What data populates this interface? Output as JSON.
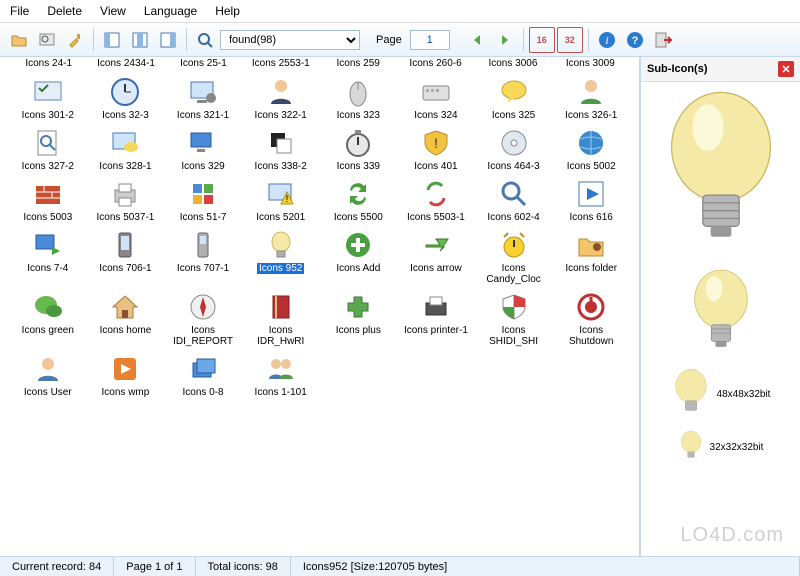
{
  "menu": [
    "File",
    "Delete",
    "View",
    "Language",
    "Help"
  ],
  "toolbar": {
    "dropdown": "found(98)",
    "page_label": "Page",
    "page_value": "1",
    "size_16": "16",
    "size_32": "32"
  },
  "header_row": [
    "Icons 24-1",
    "Icons 2434-1",
    "Icons 25-1",
    "Icons 2553-1",
    "Icons 259",
    "Icons 260-6",
    "Icons 3006",
    "Icons 3009"
  ],
  "grid": [
    {
      "name": "checklist-icon",
      "label": "Icons 301-2"
    },
    {
      "name": "clock-icon",
      "label": "Icons 32-3"
    },
    {
      "name": "monitor-gear-icon",
      "label": "Icons 321-1"
    },
    {
      "name": "user-suit-icon",
      "label": "Icons 322-1"
    },
    {
      "name": "mouse-icon",
      "label": "Icons 323"
    },
    {
      "name": "keyboard-icon",
      "label": "Icons 324"
    },
    {
      "name": "speech-bubble-icon",
      "label": "Icons 325"
    },
    {
      "name": "user-green-icon",
      "label": "Icons 326-1"
    },
    {
      "name": "search-page-icon",
      "label": "Icons 327-2"
    },
    {
      "name": "monitor-chat-icon",
      "label": "Icons 328-1"
    },
    {
      "name": "pc-blue-icon",
      "label": "Icons 329"
    },
    {
      "name": "black-square-icon",
      "label": "Icons 338-2"
    },
    {
      "name": "stopwatch-icon",
      "label": "Icons 339"
    },
    {
      "name": "shield-warn-icon",
      "label": "Icons 401"
    },
    {
      "name": "disc-icon",
      "label": "Icons 464-3"
    },
    {
      "name": "globe-icon",
      "label": "Icons 5002"
    },
    {
      "name": "firewall-icon",
      "label": "Icons 5003"
    },
    {
      "name": "printer-icon",
      "label": "Icons 5037-1"
    },
    {
      "name": "windows-blue-icon",
      "label": "Icons 51-7"
    },
    {
      "name": "monitor-warn-icon",
      "label": "Icons 5201"
    },
    {
      "name": "sync-green-icon",
      "label": "Icons 5500"
    },
    {
      "name": "sync-flags-icon",
      "label": "Icons 5503-1"
    },
    {
      "name": "magnifier-icon",
      "label": "Icons 602-4"
    },
    {
      "name": "play-icon",
      "label": "Icons 616"
    },
    {
      "name": "pc-arrow-icon",
      "label": "Icons 7-4"
    },
    {
      "name": "pda-icon",
      "label": "Icons 706-1"
    },
    {
      "name": "phone-icon",
      "label": "Icons 707-1"
    },
    {
      "name": "lightbulb-icon",
      "label": "Icons 952",
      "selected": true
    },
    {
      "name": "add-green-icon",
      "label": "Icons Add"
    },
    {
      "name": "arrow-green-icon",
      "label": "Icons arrow"
    },
    {
      "name": "alarm-clock-icon",
      "label": "Icons Candy_Cloc"
    },
    {
      "name": "folder-user-icon",
      "label": "Icons folder"
    },
    {
      "name": "chat-green-icon",
      "label": "Icons green"
    },
    {
      "name": "home-icon",
      "label": "Icons home"
    },
    {
      "name": "compass-icon",
      "label": "Icons IDI_REPORT"
    },
    {
      "name": "book-red-icon",
      "label": "Icons IDR_HwRI"
    },
    {
      "name": "plus-green-icon",
      "label": "Icons plus"
    },
    {
      "name": "printer2-icon",
      "label": "Icons printer-1"
    },
    {
      "name": "shield-color-icon",
      "label": "Icons SHIDI_SHI"
    },
    {
      "name": "shutdown-icon",
      "label": "Icons Shutdown"
    },
    {
      "name": "user-icon",
      "label": "Icons User"
    },
    {
      "name": "wmp-icon",
      "label": "Icons wmp"
    },
    {
      "name": "windows-stack-icon",
      "label": "Icons 0-8"
    },
    {
      "name": "users-group-icon",
      "label": "Icons 1-101"
    }
  ],
  "side": {
    "title": "Sub-Icon(s)",
    "caption1": "48x48x32bit",
    "caption2": "32x32x32bit"
  },
  "status": {
    "record": "Current record: 84",
    "page": "Page 1 of 1",
    "total": "Total icons: 98",
    "detail": "Icons952 [Size:120705 bytes]"
  },
  "watermark": "LO4D.com"
}
